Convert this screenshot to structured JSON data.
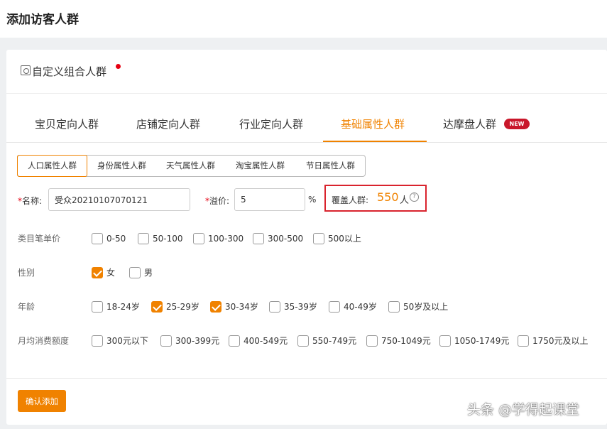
{
  "page": {
    "title": "添加访客人群"
  },
  "section": {
    "title": "自定义组合人群"
  },
  "tabs": [
    {
      "label": "宝贝定向人群"
    },
    {
      "label": "店铺定向人群"
    },
    {
      "label": "行业定向人群"
    },
    {
      "label": "基础属性人群",
      "active": true
    },
    {
      "label": "达摩盘人群",
      "badge": "NEW"
    }
  ],
  "subtabs": [
    {
      "label": "人口属性人群",
      "active": true
    },
    {
      "label": "身份属性人群"
    },
    {
      "label": "天气属性人群"
    },
    {
      "label": "淘宝属性人群"
    },
    {
      "label": "节日属性人群"
    }
  ],
  "form": {
    "name_required": "*",
    "name_label": "名称:",
    "name_value": "受众20210107070121",
    "premium_required": "*",
    "premium_label": "溢价:",
    "premium_value": "5",
    "premium_unit": "%",
    "coverage_label": "覆盖人群:",
    "coverage_value": "550",
    "coverage_unit": "人",
    "help_glyph": "?"
  },
  "rows": [
    {
      "label": "类目笔单价",
      "options": [
        {
          "label": "0-50",
          "checked": false
        },
        {
          "label": "50-100",
          "checked": false
        },
        {
          "label": "100-300",
          "checked": false
        },
        {
          "label": "300-500",
          "checked": false
        },
        {
          "label": "500以上",
          "checked": false
        }
      ]
    },
    {
      "label": "性别",
      "options": [
        {
          "label": "女",
          "checked": true
        },
        {
          "label": "男",
          "checked": false
        }
      ]
    },
    {
      "label": "年龄",
      "options": [
        {
          "label": "18-24岁",
          "checked": false
        },
        {
          "label": "25-29岁",
          "checked": true
        },
        {
          "label": "30-34岁",
          "checked": true
        },
        {
          "label": "35-39岁",
          "checked": false
        },
        {
          "label": "40-49岁",
          "checked": false
        },
        {
          "label": "50岁及以上",
          "checked": false
        }
      ]
    },
    {
      "label": "月均消费额度",
      "options": [
        {
          "label": "300元以下",
          "checked": false
        },
        {
          "label": "300-399元",
          "checked": false
        },
        {
          "label": "400-549元",
          "checked": false
        },
        {
          "label": "550-749元",
          "checked": false
        },
        {
          "label": "750-1049元",
          "checked": false
        },
        {
          "label": "1050-1749元",
          "checked": false
        },
        {
          "label": "1750元及以上",
          "checked": false
        }
      ]
    }
  ],
  "actions": {
    "confirm_label": "确认添加"
  },
  "watermark": "头条 @学得起课堂",
  "colors": {
    "accent": "#f08200",
    "highlight_border": "#d9232d",
    "badge": "#c9172a"
  }
}
